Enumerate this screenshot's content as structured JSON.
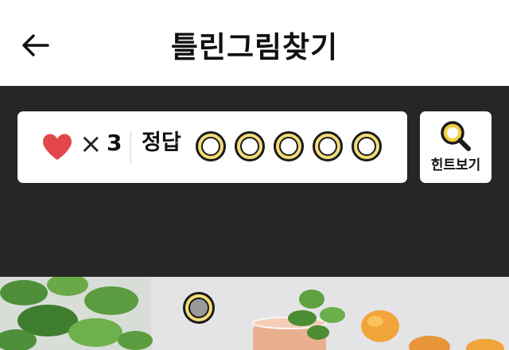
{
  "header": {
    "back_icon": "arrow-left-icon",
    "title": "틀린그림찾기"
  },
  "status": {
    "lives_icon": "heart-icon",
    "heart_color": "#e3464b",
    "times_symbol": "×",
    "lives": "3",
    "answer_label": "정답",
    "answers_found": 0,
    "answers_total": 5
  },
  "hint": {
    "icon": "magnifier-icon",
    "label": "힌트보기"
  },
  "scene": {
    "description_icon": "photo-scene",
    "marker_icon": "found-circle-icon"
  },
  "colors": {
    "panel_bg": "#262626",
    "slot_fill": "#f3dd78",
    "accent_yellow": "#f0cf3c"
  }
}
